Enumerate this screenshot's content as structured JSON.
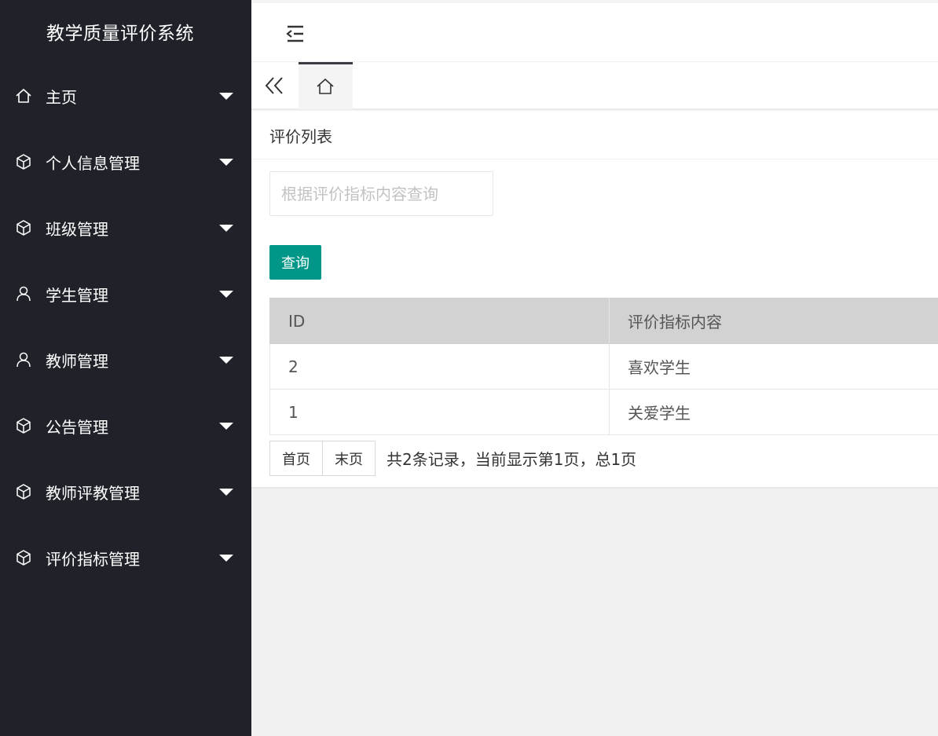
{
  "app": {
    "title": "教学质量评价系统"
  },
  "sidebar": {
    "items": [
      {
        "label": "主页",
        "icon": "home-icon"
      },
      {
        "label": "个人信息管理",
        "icon": "cube-icon"
      },
      {
        "label": "班级管理",
        "icon": "cube-icon"
      },
      {
        "label": "学生管理",
        "icon": "user-icon"
      },
      {
        "label": "教师管理",
        "icon": "user-icon"
      },
      {
        "label": "公告管理",
        "icon": "cube-icon"
      },
      {
        "label": "教师评教管理",
        "icon": "cube-icon"
      },
      {
        "label": "评价指标管理",
        "icon": "cube-icon"
      }
    ]
  },
  "header": {
    "toggle_icon": "menu-collapse-icon"
  },
  "tabs": {
    "scroll_left_icon": "double-chevron-left-icon",
    "home_icon": "home-icon"
  },
  "main": {
    "title": "评价列表",
    "search": {
      "placeholder": "根据评价指标内容查询",
      "value": ""
    },
    "query_button": "查询",
    "table": {
      "headers": [
        "ID",
        "评价指标内容"
      ],
      "rows": [
        [
          "2",
          "喜欢学生"
        ],
        [
          "1",
          "关爱学生"
        ]
      ]
    },
    "pager": {
      "first": "首页",
      "last": "末页",
      "info": "共2条记录，当前显示第1页，总1页"
    }
  },
  "colors": {
    "sidebar_bg": "#20222a",
    "accent": "#009688",
    "table_header_bg": "#d2d2d2",
    "page_bg": "#f0f0f0"
  }
}
